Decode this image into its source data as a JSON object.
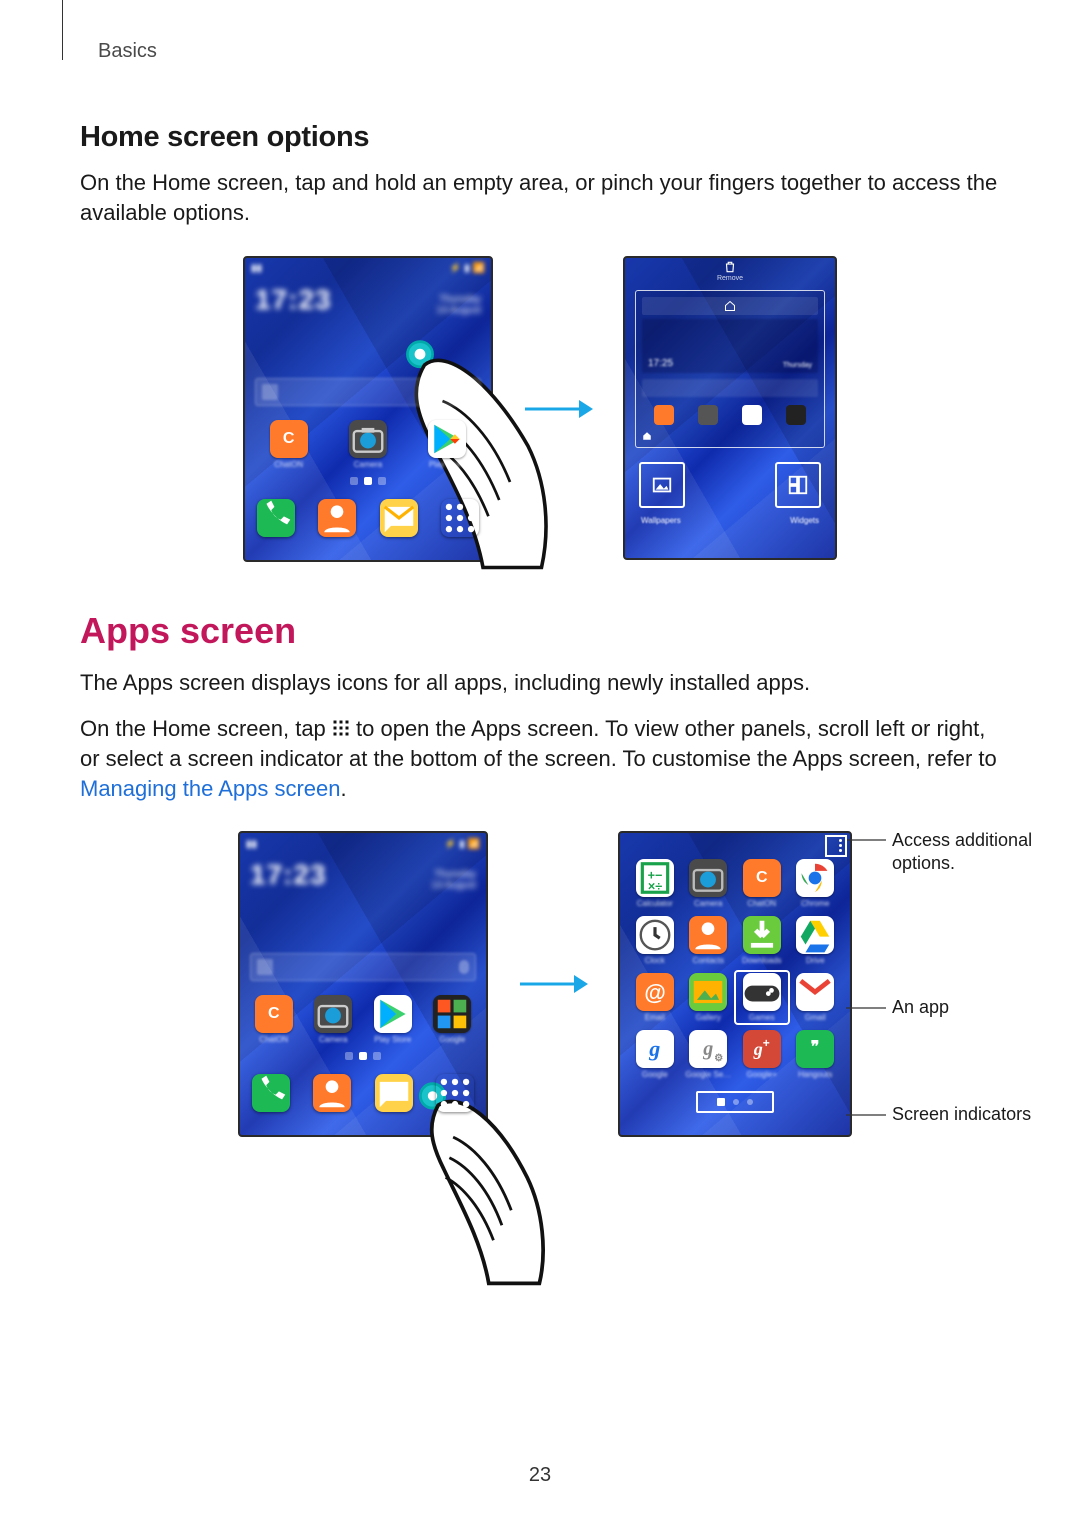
{
  "chapter": "Basics",
  "section1": {
    "heading": "Home screen options",
    "body": "On the Home screen, tap and hold an empty area, or pinch your fingers together to access the available options."
  },
  "section2": {
    "heading": "Apps screen",
    "p1": "The Apps screen displays icons for all apps, including newly installed apps.",
    "p2a": "On the Home screen, tap ",
    "p2b": " to open the Apps screen. To view other panels, scroll left or right, or select a screen indicator at the bottom of the screen. To customise the Apps screen, refer to ",
    "link": "Managing the Apps screen",
    "p2c": "."
  },
  "callouts": {
    "options": "Access additional options.",
    "app": "An app",
    "indicators": "Screen indicators"
  },
  "page_number": "23"
}
